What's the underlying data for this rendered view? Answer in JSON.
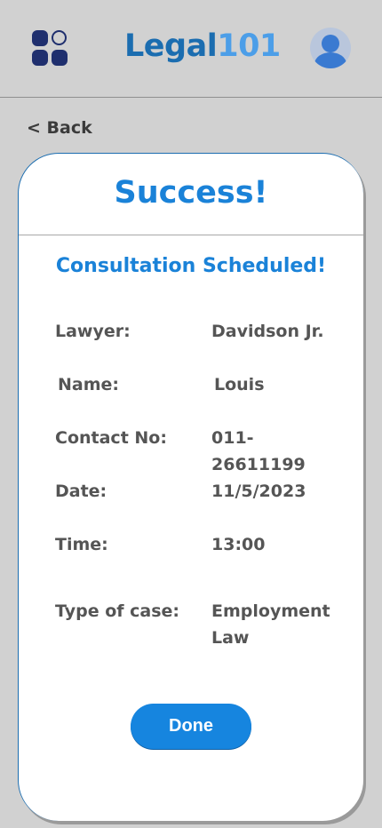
{
  "header": {
    "logo_main": "Legal",
    "logo_num": "101"
  },
  "nav": {
    "back_label": "< Back"
  },
  "card": {
    "title": "Success!",
    "subtitle": "Consultation Scheduled!",
    "details": [
      {
        "label": "Lawyer:",
        "value": "Davidson Jr."
      },
      {
        "label": "Name:",
        "value": "Louis"
      },
      {
        "label": "Contact No:",
        "value": "011-26611199"
      },
      {
        "label": "Date:",
        "value": "11/5/2023"
      },
      {
        "label": "Time:",
        "value": "13:00"
      },
      {
        "label": "Type of case:",
        "value": "Employment Law"
      }
    ],
    "done_label": "Done"
  },
  "colors": {
    "accent": "#1a82d8",
    "logo_dark": "#1b6db0",
    "logo_light": "#4c9ee8",
    "icon_dark": "#1f2f6e",
    "background": "#d1d1d1"
  },
  "icons": {
    "menu": "apps-grid-icon",
    "profile": "user-avatar-icon"
  }
}
